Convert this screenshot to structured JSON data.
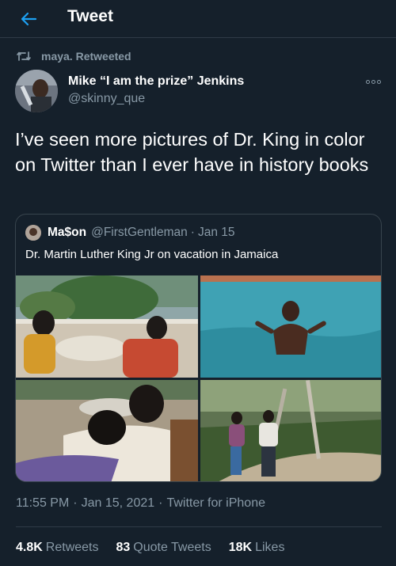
{
  "header": {
    "title": "Tweet",
    "back_icon": "arrow-left-icon"
  },
  "retweet": {
    "icon": "retweet-icon",
    "label": "maya. Retweeted"
  },
  "tweet": {
    "author_name": "Mike “I am the prize” Jenkins",
    "author_handle": "@skinny_que",
    "text": "I’ve seen more pictures of Dr. King in color on Twitter than I ever have in history books",
    "more_icon": "more-icon"
  },
  "quote": {
    "name": "Ma$on",
    "handle": "@FirstGentleman",
    "dot": "·",
    "date": "Jan 15",
    "text": "Dr. Martin Luther King Jr on vacation in Jamaica"
  },
  "meta": {
    "time": "11:55 PM",
    "sep1": "·",
    "date": "Jan 15, 2021",
    "sep2": "·",
    "source": "Twitter for iPhone"
  },
  "stats": [
    {
      "count": "4.8K",
      "label": "Retweets"
    },
    {
      "count": "83",
      "label": "Quote Tweets"
    },
    {
      "count": "18K",
      "label": "Likes"
    }
  ],
  "colors": {
    "background": "#15202b",
    "secondary_text": "#8899a6",
    "accent": "#1da1f2",
    "border": "#38444d"
  }
}
